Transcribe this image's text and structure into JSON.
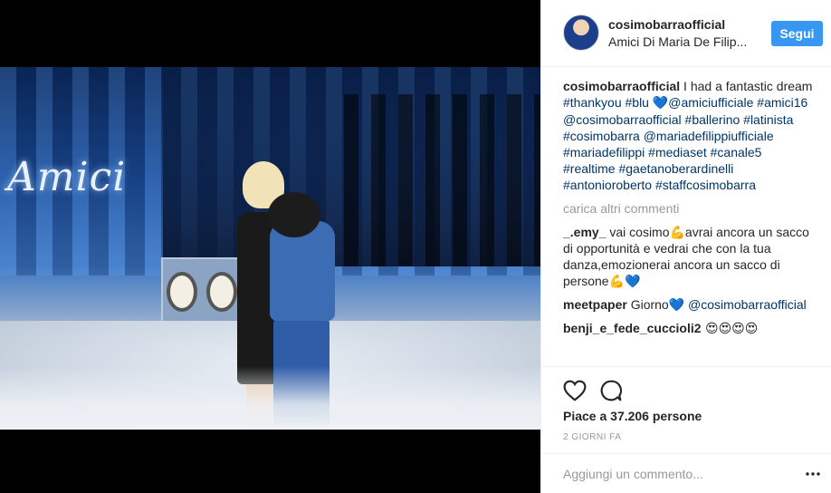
{
  "post": {
    "image_alt": "Amici"
  },
  "header": {
    "username": "cosimobarraofficial",
    "location": "Amici Di Maria De Filip...",
    "follow_label": "Segui"
  },
  "caption": {
    "username": "cosimobarraofficial",
    "text_start": " I had a fantastic dream ",
    "tags_line1": "#thankyou #blu",
    "heart": "💙",
    "tags_rest": "@amiciufficiale #amici16 @cosimobarraofficial #ballerino #latinista #cosimobarra @mariadefilippiufficiale #mariadefilippi #mediaset #canale5 #realtime #gaetanoberardinelli #antonioroberto #staffcosimobarra"
  },
  "load_more": "carica altri commenti",
  "comments": [
    {
      "username": "_.emy_",
      "text": " vai cosimo💪avrai ancora un sacco di opportunità e vedrai che con la tua danza,emozionerai ancora un sacco di persone💪💙"
    },
    {
      "username": "meetpaper",
      "text": " Giorno💙 ",
      "mention": "@cosimobarraofficial"
    },
    {
      "username": "benji_e_fede_cuccioli2",
      "text": " 😍😍😍😍"
    }
  ],
  "actions": {
    "likes": "Piace a 37.206 persone",
    "time": "2 GIORNI FA"
  },
  "add_comment": {
    "placeholder": "Aggiungi un commento..."
  },
  "icons": {
    "like": "heart-icon",
    "comment": "comment-icon",
    "more": "more-options-icon"
  }
}
